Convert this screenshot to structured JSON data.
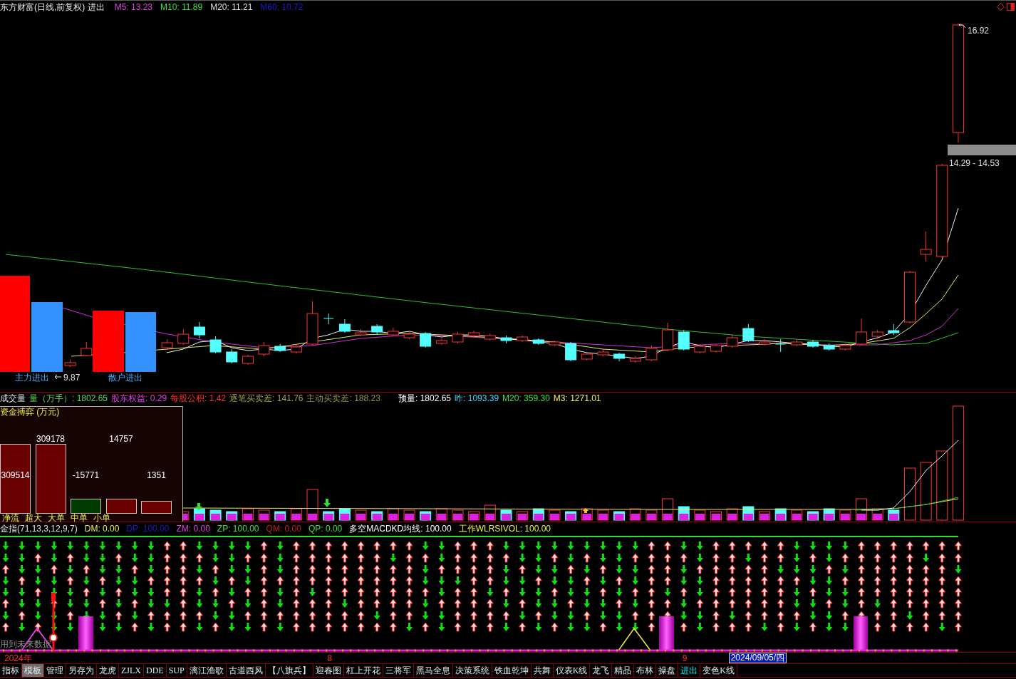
{
  "header": {
    "title": "东方财富(日线,前复权) 进出",
    "averages": [
      {
        "text": "M5: 13.23",
        "color": "#e040e0"
      },
      {
        "text": "M10: 11.89",
        "color": "#40e040"
      },
      {
        "text": "M20: 11.21",
        "color": "#e0e0e0"
      },
      {
        "text": "M60: 10.72",
        "color": "#1c1cc8"
      }
    ]
  },
  "price_chart": {
    "high_label": "16.92",
    "low_label": "9.87",
    "range_label": "14.29 - 14.53",
    "flow_labels": [
      "主力进出",
      "散户进出"
    ]
  },
  "volume_panel": {
    "title": "成交量",
    "readings": [
      {
        "text": "量（万手）: 1802.65",
        "color": "#60d860"
      },
      {
        "text": "股东权益: 0.29",
        "color": "#e040e0"
      },
      {
        "text": "每股公积: 1.42",
        "color": "#ff3030"
      },
      {
        "text": "逐笔买卖差: 141.76",
        "color": "#a0a050"
      },
      {
        "text": "主动买卖差: 188.23",
        "color": "#909050"
      }
    ],
    "forecast": [
      {
        "text": "预量: 1802.65",
        "color": "#ffffff"
      },
      {
        "text": "昨: 1093.39",
        "color": "#40d8ff"
      },
      {
        "text": "M20: 359.30",
        "color": "#40e040"
      },
      {
        "text": "M3: 1271.01",
        "color": "#f0f060"
      }
    ],
    "fund_flow": {
      "title": "资金搏弈 (万元)",
      "items": [
        {
          "label": "净流",
          "value": "309514",
          "level": 1.0,
          "color": "#6a0000"
        },
        {
          "label": "超大",
          "value": "309178",
          "level": 1.0,
          "color": "#6a0000"
        },
        {
          "label": "大单",
          "value": "-15771",
          "level": 0.21,
          "color": "#003c00"
        },
        {
          "label": "中单",
          "value": "14757",
          "level": 0.21,
          "color": "#6a0000"
        },
        {
          "label": "小单",
          "value": "1351",
          "level": 0.18,
          "color": "#6a0000"
        }
      ]
    }
  },
  "indicator_panel": {
    "readings": [
      {
        "text": "金指(71,13,3,12,9,7)",
        "color": "#e0e0e0"
      },
      {
        "text": "DM: 0.00",
        "color": "#f0f040"
      },
      {
        "text": "DP: 100.00",
        "color": "#1c1cc8"
      },
      {
        "text": "ZM: 0.00",
        "color": "#e040e0"
      },
      {
        "text": "ZP: 100.00",
        "color": "#40e040"
      },
      {
        "text": "QM: 0.00",
        "color": "#c02020"
      },
      {
        "text": "QP: 0.00",
        "color": "#40e040"
      },
      {
        "text": "多空MACDKD均线: 100.00",
        "color": "#ffffff"
      },
      {
        "text": "工作WLRSIVOL: 100.00",
        "color": "#f0f040"
      }
    ],
    "warning": "用到未来数据"
  },
  "date_axis": {
    "labels": [
      "2024年",
      "8",
      "9"
    ],
    "cursor_date": "2024/09/05/四"
  },
  "tabs": [
    {
      "label": "指标",
      "selected": false,
      "pressed": false
    },
    {
      "label": "模板",
      "selected": false,
      "pressed": true
    },
    {
      "label": "管理",
      "selected": false,
      "pressed": false
    },
    {
      "label": "另存为",
      "selected": false,
      "pressed": false
    },
    {
      "label": "龙虎",
      "selected": false,
      "pressed": false
    },
    {
      "label": "ZJLX",
      "selected": false,
      "pressed": false
    },
    {
      "label": "DDE",
      "selected": false,
      "pressed": false
    },
    {
      "label": "SUP",
      "selected": false,
      "pressed": false
    },
    {
      "label": "漓江渔歌",
      "selected": false,
      "pressed": false
    },
    {
      "label": "古道西风",
      "selected": false,
      "pressed": false
    },
    {
      "label": "【八旗兵】",
      "selected": false,
      "pressed": false
    },
    {
      "label": "迎春图",
      "selected": false,
      "pressed": false
    },
    {
      "label": "杠上开花",
      "selected": false,
      "pressed": false
    },
    {
      "label": "三将军",
      "selected": false,
      "pressed": false
    },
    {
      "label": "黑马全息",
      "selected": false,
      "pressed": false
    },
    {
      "label": "决策系统",
      "selected": false,
      "pressed": false
    },
    {
      "label": "铁血乾坤",
      "selected": false,
      "pressed": false
    },
    {
      "label": "共舞",
      "selected": false,
      "pressed": false
    },
    {
      "label": "仪表K线",
      "selected": false,
      "pressed": false
    },
    {
      "label": "龙飞",
      "selected": false,
      "pressed": false
    },
    {
      "label": "精品",
      "selected": false,
      "pressed": false
    },
    {
      "label": "布林",
      "selected": false,
      "pressed": false
    },
    {
      "label": "操盘",
      "selected": false,
      "pressed": false
    },
    {
      "label": "进出",
      "selected": true,
      "pressed": false
    },
    {
      "label": "变色K线",
      "selected": false,
      "pressed": false
    }
  ]
}
